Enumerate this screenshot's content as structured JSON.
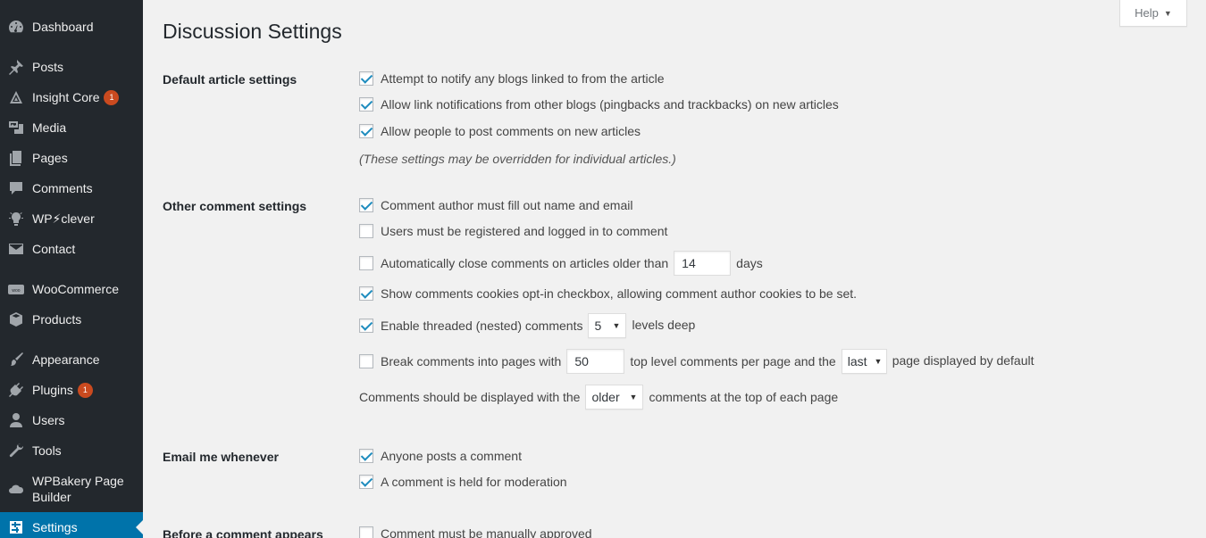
{
  "sidebar": {
    "items": [
      {
        "label": "Dashboard",
        "icon": "dashboard-icon"
      },
      {
        "label": "Posts",
        "icon": "pin-icon"
      },
      {
        "label": "Insight Core",
        "icon": "insight-core-icon",
        "badge": "1"
      },
      {
        "label": "Media",
        "icon": "media-icon"
      },
      {
        "label": "Pages",
        "icon": "pages-icon"
      },
      {
        "label": "Comments",
        "icon": "comment-icon"
      },
      {
        "label": "WP⚡clever",
        "icon": "lightbulb-icon"
      },
      {
        "label": "Contact",
        "icon": "envelope-icon"
      },
      {
        "label": "WooCommerce",
        "icon": "woocommerce-icon"
      },
      {
        "label": "Products",
        "icon": "box-icon"
      },
      {
        "label": "Appearance",
        "icon": "brush-icon"
      },
      {
        "label": "Plugins",
        "icon": "plugin-icon",
        "badge": "1"
      },
      {
        "label": "Users",
        "icon": "user-icon"
      },
      {
        "label": "Tools",
        "icon": "wrench-icon"
      },
      {
        "label": "WPBakery Page Builder",
        "icon": "cloud-icon"
      },
      {
        "label": "Settings",
        "icon": "settings-icon"
      }
    ]
  },
  "header": {
    "title": "Discussion Settings",
    "help_label": "Help"
  },
  "sections": {
    "default_article": {
      "label": "Default article settings",
      "options": [
        {
          "label": "Attempt to notify any blogs linked to from the article",
          "checked": true
        },
        {
          "label": "Allow link notifications from other blogs (pingbacks and trackbacks) on new articles",
          "checked": true
        },
        {
          "label": "Allow people to post comments on new articles",
          "checked": true
        }
      ],
      "note": "(These settings may be overridden for individual articles.)"
    },
    "other_comment": {
      "label": "Other comment settings",
      "author_fill": {
        "label": "Comment author must fill out name and email",
        "checked": true
      },
      "registered": {
        "label": "Users must be registered and logged in to comment",
        "checked": false
      },
      "auto_close": {
        "prefix": "Automatically close comments on articles older than",
        "value": "14",
        "suffix": "days",
        "checked": false
      },
      "cookies": {
        "label": "Show comments cookies opt-in checkbox, allowing comment author cookies to be set.",
        "checked": true
      },
      "threaded": {
        "prefix": "Enable threaded (nested) comments",
        "value": "5",
        "suffix": "levels deep",
        "checked": true
      },
      "paging": {
        "prefix": "Break comments into pages with",
        "value": "50",
        "middle": "top level comments per page and the",
        "select": "last",
        "suffix": "page displayed by default",
        "checked": false
      },
      "order": {
        "prefix": "Comments should be displayed with the",
        "select": "older",
        "suffix": "comments at the top of each page"
      }
    },
    "email": {
      "label": "Email me whenever",
      "options": [
        {
          "label": "Anyone posts a comment",
          "checked": true
        },
        {
          "label": "A comment is held for moderation",
          "checked": true
        }
      ]
    },
    "before_appears": {
      "label": "Before a comment appears",
      "options": [
        {
          "label": "Comment must be manually approved",
          "checked": false
        }
      ]
    }
  },
  "colors": {
    "sidebar_bg": "#23282d",
    "current_bg": "#0073aa",
    "badge": "#ca4a1f",
    "check": "#1e8cbe"
  }
}
